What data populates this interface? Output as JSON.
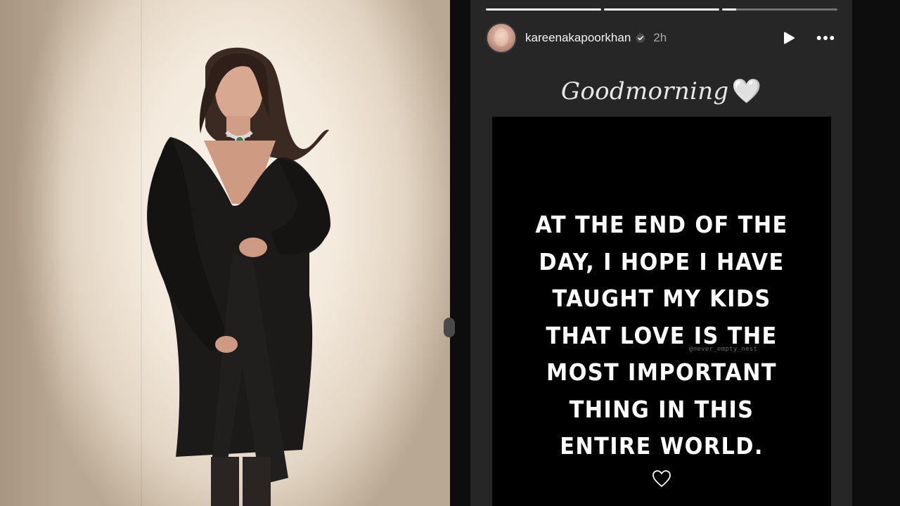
{
  "photo": {
    "subject": "woman-in-black-dress-photo"
  },
  "story": {
    "progress": [
      1.0,
      1.0,
      0.12
    ],
    "user": {
      "username": "kareenakapoorkhan",
      "verified": true,
      "time": "2h"
    },
    "controls": {
      "play_icon": "play-icon",
      "more_icon": "more-horizontal-icon"
    },
    "caption": {
      "text": "Goodmorning",
      "emoji": "🤍"
    },
    "quote": {
      "lines": [
        "AT THE END OF THE",
        "DAY, I HOPE I HAVE",
        "TAUGHT MY KIDS",
        "THAT LOVE IS THE",
        "MOST IMPORTANT",
        "THING IN THIS",
        "ENTIRE WORLD."
      ],
      "watermark": "@never_empty_nest",
      "heart_icon": "heart-outline-icon"
    }
  },
  "colors": {
    "story_bg": "#262626",
    "quote_bg": "#000000",
    "text": "#ffffff",
    "muted": "#a8a8a8",
    "verified_badge": "#4a4a4a"
  }
}
